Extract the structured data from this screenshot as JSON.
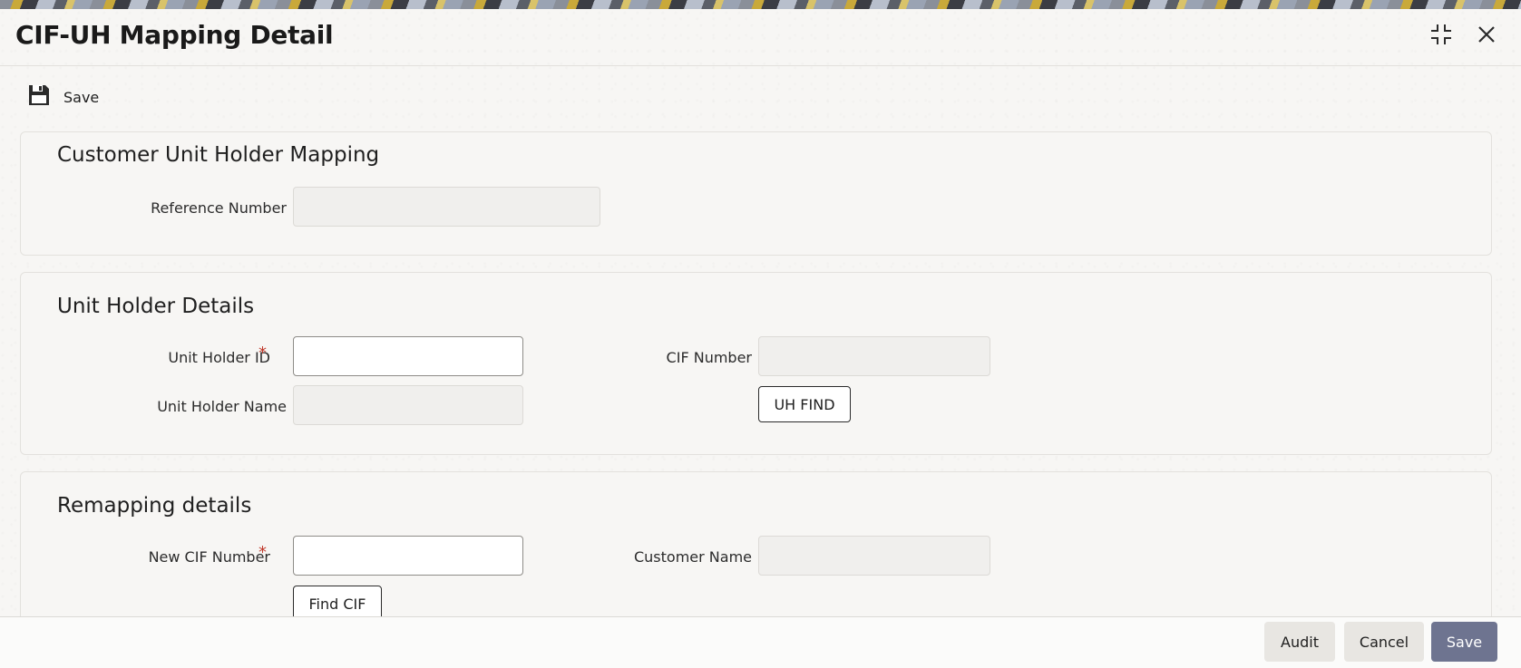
{
  "window": {
    "title": "CIF-UH Mapping Detail"
  },
  "toolbar": {
    "save_label": "Save"
  },
  "section_mapping": {
    "title": "Customer Unit Holder Mapping",
    "reference_number": {
      "label": "Reference Number",
      "value": ""
    }
  },
  "section_unit_holder": {
    "title": "Unit Holder Details",
    "unit_holder_id": {
      "label": "Unit Holder ID",
      "required_mark": "*",
      "value": ""
    },
    "unit_holder_name": {
      "label": "Unit Holder Name",
      "value": ""
    },
    "cif_number": {
      "label": "CIF Number",
      "value": ""
    },
    "uh_find_label": "UH FIND"
  },
  "section_remapping": {
    "title": "Remapping details",
    "new_cif_number": {
      "label": "New CIF Number",
      "required_mark": "*",
      "value": ""
    },
    "customer_name": {
      "label": "Customer Name",
      "value": ""
    },
    "find_cif_label": "Find CIF"
  },
  "footer": {
    "audit_label": "Audit",
    "cancel_label": "Cancel",
    "save_label": "Save"
  },
  "colors": {
    "primary_button": "#6e7490",
    "required_mark": "#c0392b",
    "secondary_button": "#e8e6e2"
  },
  "icons": {
    "save": "floppy-disk-icon",
    "minimize": "collapse-icon",
    "close": "close-icon"
  }
}
